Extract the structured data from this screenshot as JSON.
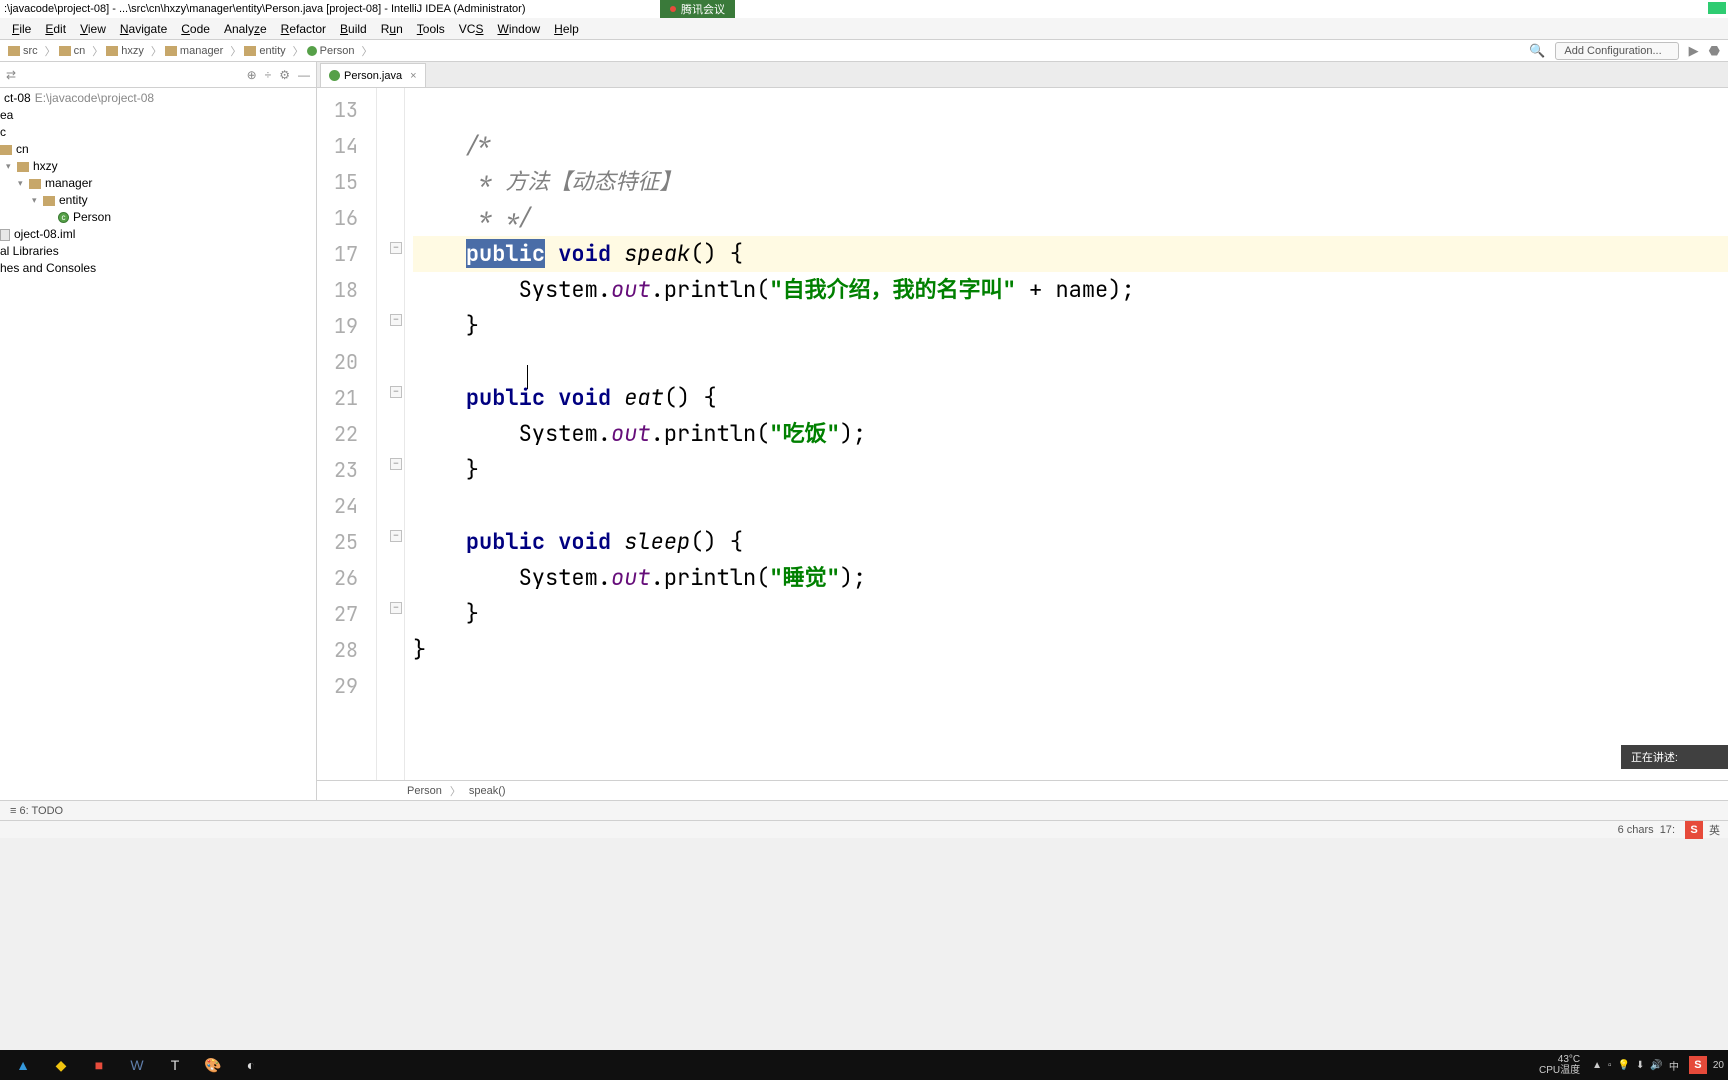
{
  "title": ":\\javacode\\project-08] - ...\\src\\cn\\hxzy\\manager\\entity\\Person.java [project-08] - IntelliJ IDEA (Administrator)",
  "meeting_badge": "腾讯会议",
  "menu": [
    "File",
    "Edit",
    "View",
    "Navigate",
    "Code",
    "Analyze",
    "Refactor",
    "Build",
    "Run",
    "Tools",
    "VCS",
    "Window",
    "Help"
  ],
  "breadcrumbs": [
    "src",
    "cn",
    "hxzy",
    "manager",
    "entity",
    "Person"
  ],
  "config_dropdown": "Add Configuration...",
  "project_root": "ct-08",
  "project_path": "E:\\javacode\\project-08",
  "tree": {
    "ea": "ea",
    "c": "c",
    "cn": "cn",
    "hxzy": "hxzy",
    "manager": "manager",
    "entity": "entity",
    "person": "Person",
    "iml": "oject-08.iml",
    "al_libraries": "al Libraries",
    "hes_consoles": "hes and Consoles"
  },
  "editor_tab": "Person.java",
  "gutter_lines": [
    "13",
    "14",
    "15",
    "16",
    "17",
    "18",
    "19",
    "20",
    "21",
    "22",
    "23",
    "24",
    "25",
    "26",
    "27",
    "28",
    "29"
  ],
  "code": {
    "comment_start": "/*",
    "comment_line": " * 方法【动态特征】",
    "comment_end": " * */",
    "kw_public": "public",
    "kw_void": "void",
    "method_speak": "speak",
    "sys": "System.",
    "out": "out",
    "println": ".println(",
    "str_speak": "\"自我介绍，我的名字叫\"",
    "plus_name": " + name);",
    "method_eat": "eat",
    "str_eat": "\"吃饭\"",
    "method_sleep": "sleep",
    "str_sleep": "\"睡觉\"",
    "close_paren_semi": ");",
    "brace_open": " {",
    "brace_close": "}",
    "paren_empty": "()"
  },
  "editor_breadcrumb": {
    "class": "Person",
    "method": "speak()"
  },
  "speaker_overlay": "正在讲述:",
  "bottom_todo": "6: TODO",
  "status_right": {
    "chars": "6 chars",
    "pos": "17"
  },
  "ime_lang": "英",
  "taskbar": {
    "temp": "43°C",
    "temp_label": "CPU温度",
    "time": "20",
    "tray_lang": "中"
  }
}
